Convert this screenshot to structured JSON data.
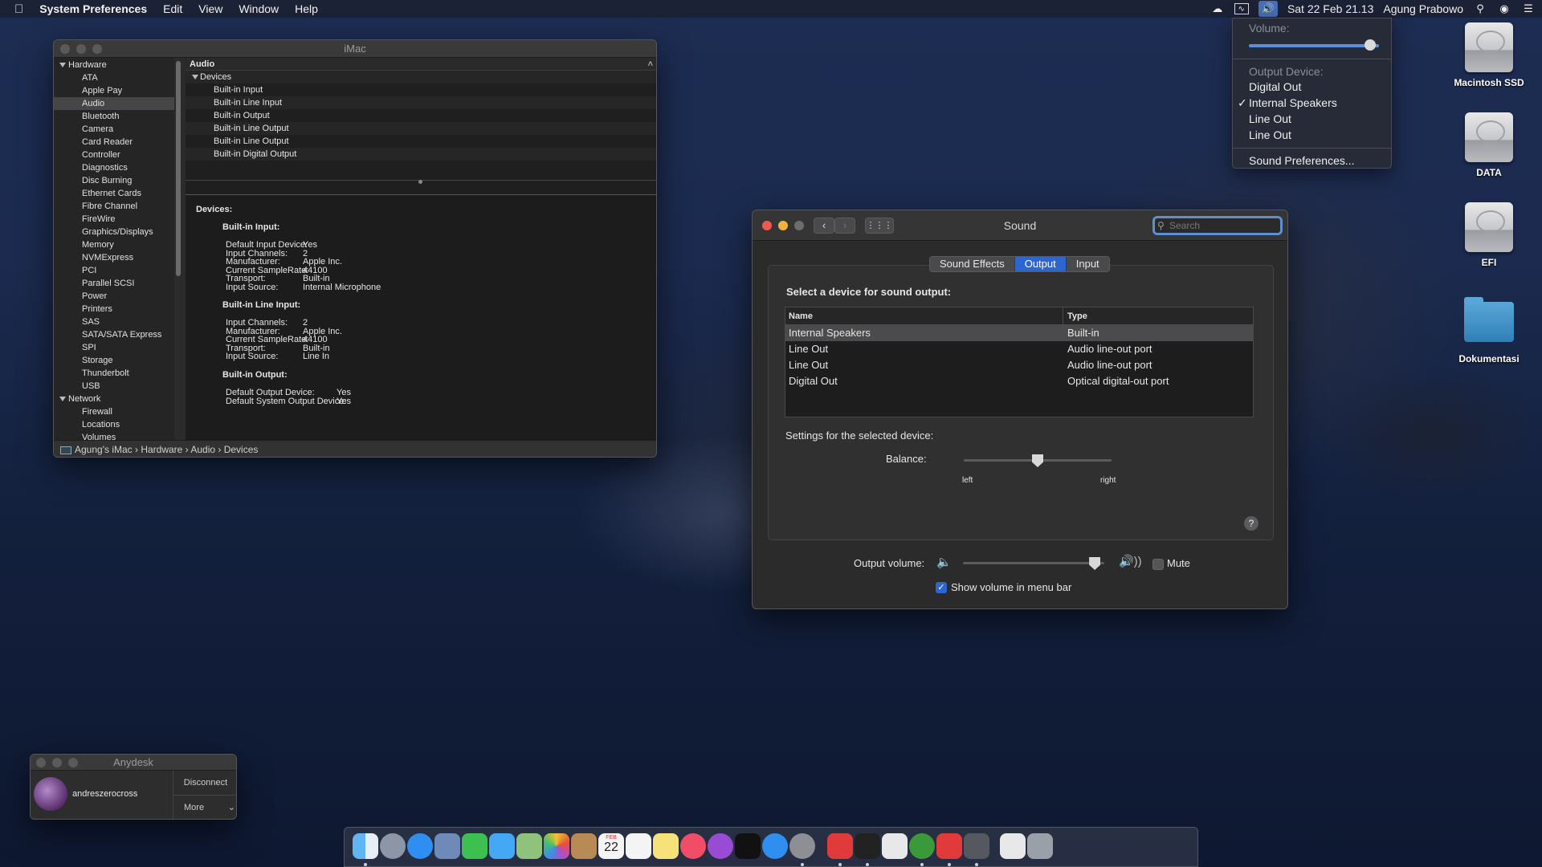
{
  "menubar": {
    "app": "System Preferences",
    "items": [
      "Edit",
      "View",
      "Window",
      "Help"
    ],
    "datetime": "Sat 22 Feb  21.13",
    "user": "Agung Prabowo"
  },
  "volume_menu": {
    "volume_label": "Volume:",
    "volume_level": 0.97,
    "output_label": "Output Device:",
    "devices": [
      {
        "name": "Digital Out",
        "checked": false
      },
      {
        "name": "Internal Speakers",
        "checked": true
      },
      {
        "name": "Line Out",
        "checked": false
      },
      {
        "name": "Line Out",
        "checked": false
      }
    ],
    "prefs": "Sound Preferences...",
    "check": "✓"
  },
  "desktop": {
    "icons": [
      {
        "label": "Macintosh SSD",
        "kind": "drive"
      },
      {
        "label": "DATA",
        "kind": "drive"
      },
      {
        "label": "EFI",
        "kind": "drive"
      },
      {
        "label": "Dokumentasi",
        "kind": "folder"
      }
    ]
  },
  "sysinfo": {
    "title": "iMac",
    "sidebar": [
      {
        "label": "Hardware",
        "group": true
      },
      {
        "label": "ATA"
      },
      {
        "label": "Apple Pay"
      },
      {
        "label": "Audio",
        "selected": true
      },
      {
        "label": "Bluetooth"
      },
      {
        "label": "Camera"
      },
      {
        "label": "Card Reader"
      },
      {
        "label": "Controller"
      },
      {
        "label": "Diagnostics"
      },
      {
        "label": "Disc Burning"
      },
      {
        "label": "Ethernet Cards"
      },
      {
        "label": "Fibre Channel"
      },
      {
        "label": "FireWire"
      },
      {
        "label": "Graphics/Displays"
      },
      {
        "label": "Memory"
      },
      {
        "label": "NVMExpress"
      },
      {
        "label": "PCI"
      },
      {
        "label": "Parallel SCSI"
      },
      {
        "label": "Power"
      },
      {
        "label": "Printers"
      },
      {
        "label": "SAS"
      },
      {
        "label": "SATA/SATA Express"
      },
      {
        "label": "SPI"
      },
      {
        "label": "Storage"
      },
      {
        "label": "Thunderbolt"
      },
      {
        "label": "USB"
      },
      {
        "label": "Network",
        "group": true
      },
      {
        "label": "Firewall"
      },
      {
        "label": "Locations"
      },
      {
        "label": "Volumes"
      }
    ],
    "top_header": "Audio",
    "devices_label": "Devices",
    "device_list": [
      "Built-in Input",
      "Built-in Line Input",
      "Built-in Output",
      "Built-in Line Output",
      "Built-in Line Output",
      "Built-in Digital Output"
    ],
    "detail": {
      "heading": "Devices:",
      "sections": [
        {
          "title": "Built-in Input:",
          "rows": [
            [
              "Default Input Device:",
              "Yes"
            ],
            [
              "Input Channels:",
              "2"
            ],
            [
              "Manufacturer:",
              "Apple Inc."
            ],
            [
              "Current SampleRate:",
              "44100"
            ],
            [
              "Transport:",
              "Built-in"
            ],
            [
              "Input Source:",
              "Internal Microphone"
            ]
          ]
        },
        {
          "title": "Built-in Line Input:",
          "rows": [
            [
              "Input Channels:",
              "2"
            ],
            [
              "Manufacturer:",
              "Apple Inc."
            ],
            [
              "Current SampleRate:",
              "44100"
            ],
            [
              "Transport:",
              "Built-in"
            ],
            [
              "Input Source:",
              "Line In"
            ]
          ]
        },
        {
          "title": "Built-in Output:",
          "rows": [
            [
              "Default Output Device:",
              "Yes"
            ],
            [
              "Default System Output Device:",
              "Yes"
            ]
          ]
        }
      ]
    },
    "path": "Agung's iMac  ›  Hardware  ›  Audio  ›  Devices"
  },
  "sound": {
    "title": "Sound",
    "search_placeholder": "Search",
    "tabs": [
      "Sound Effects",
      "Output",
      "Input"
    ],
    "active_tab": "Output",
    "select_label": "Select a device for sound output:",
    "columns": [
      "Name",
      "Type"
    ],
    "rows": [
      [
        "Internal Speakers",
        "Built-in"
      ],
      [
        "Line Out",
        "Audio line-out port"
      ],
      [
        "Line Out",
        "Audio line-out port"
      ],
      [
        "Digital Out",
        "Optical digital-out port"
      ]
    ],
    "settings_label": "Settings for the selected device:",
    "balance_label": "Balance:",
    "balance_left": "left",
    "balance_right": "right",
    "balance_value": 0.5,
    "output_volume_label": "Output volume:",
    "output_volume": 0.97,
    "mute_label": "Mute",
    "mute_checked": false,
    "show_volume_label": "Show volume in menu bar",
    "show_volume_checked": true,
    "help": "?"
  },
  "anydesk": {
    "title": "Anydesk",
    "user": "andreszerocross",
    "disconnect": "Disconnect",
    "more": "More"
  },
  "dock": {
    "calendar_month": "FEB",
    "calendar_day": "22",
    "apps": [
      "finder",
      "launchpad",
      "safari",
      "preview",
      "facetime",
      "messages",
      "maps",
      "photos",
      "contacts",
      "calendar",
      "reminders",
      "notes",
      "music",
      "podcasts",
      "apple-tv",
      "app-store",
      "system-preferences",
      "anydesk",
      "terminal",
      "textedit",
      "network-utility",
      "anydesk-2",
      "xcode-tool",
      "documents",
      "trash"
    ]
  },
  "colors": {
    "accent": "#2d66d0",
    "menubar": "#1c2234",
    "window": "#2b2b2c"
  }
}
